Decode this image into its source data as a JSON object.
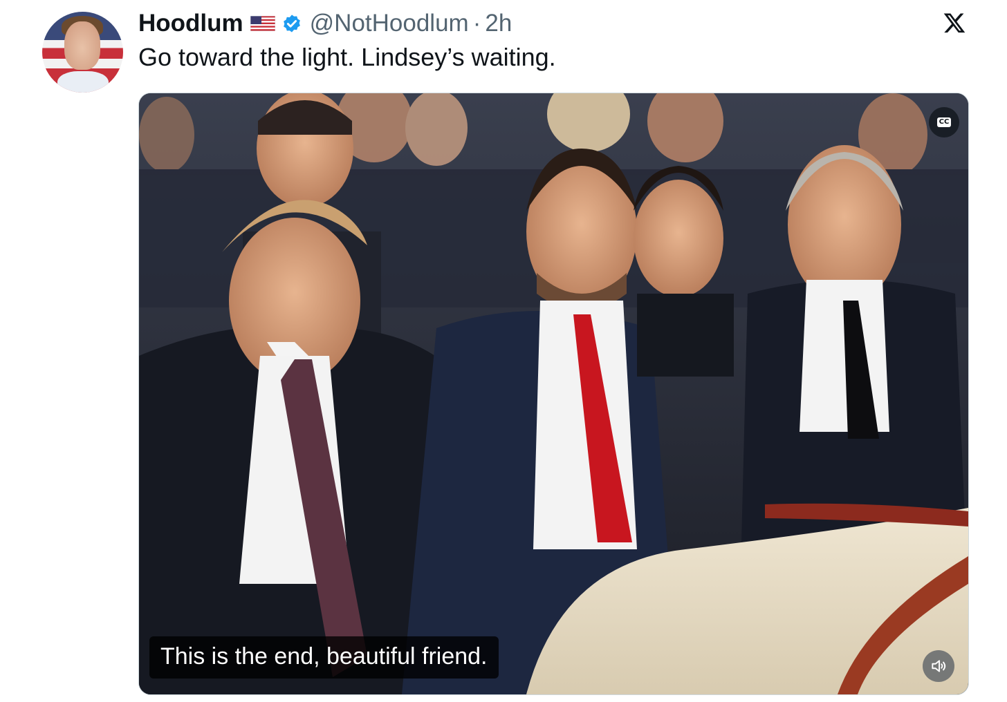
{
  "tweet": {
    "display_name": "Hoodlum",
    "name_emoji": "flag-us-icon",
    "verified": true,
    "handle": "@NotHoodlum",
    "separator": "·",
    "time_ago": "2h",
    "text": "Go toward the light. Lindsey’s waiting."
  },
  "media": {
    "type": "video",
    "caption": "This is the end, beautiful friend.",
    "cc_label": "CC",
    "icons": [
      "closed-captions-icon",
      "volume-icon"
    ]
  },
  "brand": {
    "logo": "x-logo-icon",
    "verified_color": "#1d9bf0",
    "text_color": "#0f1419",
    "secondary_text_color": "#536471"
  }
}
